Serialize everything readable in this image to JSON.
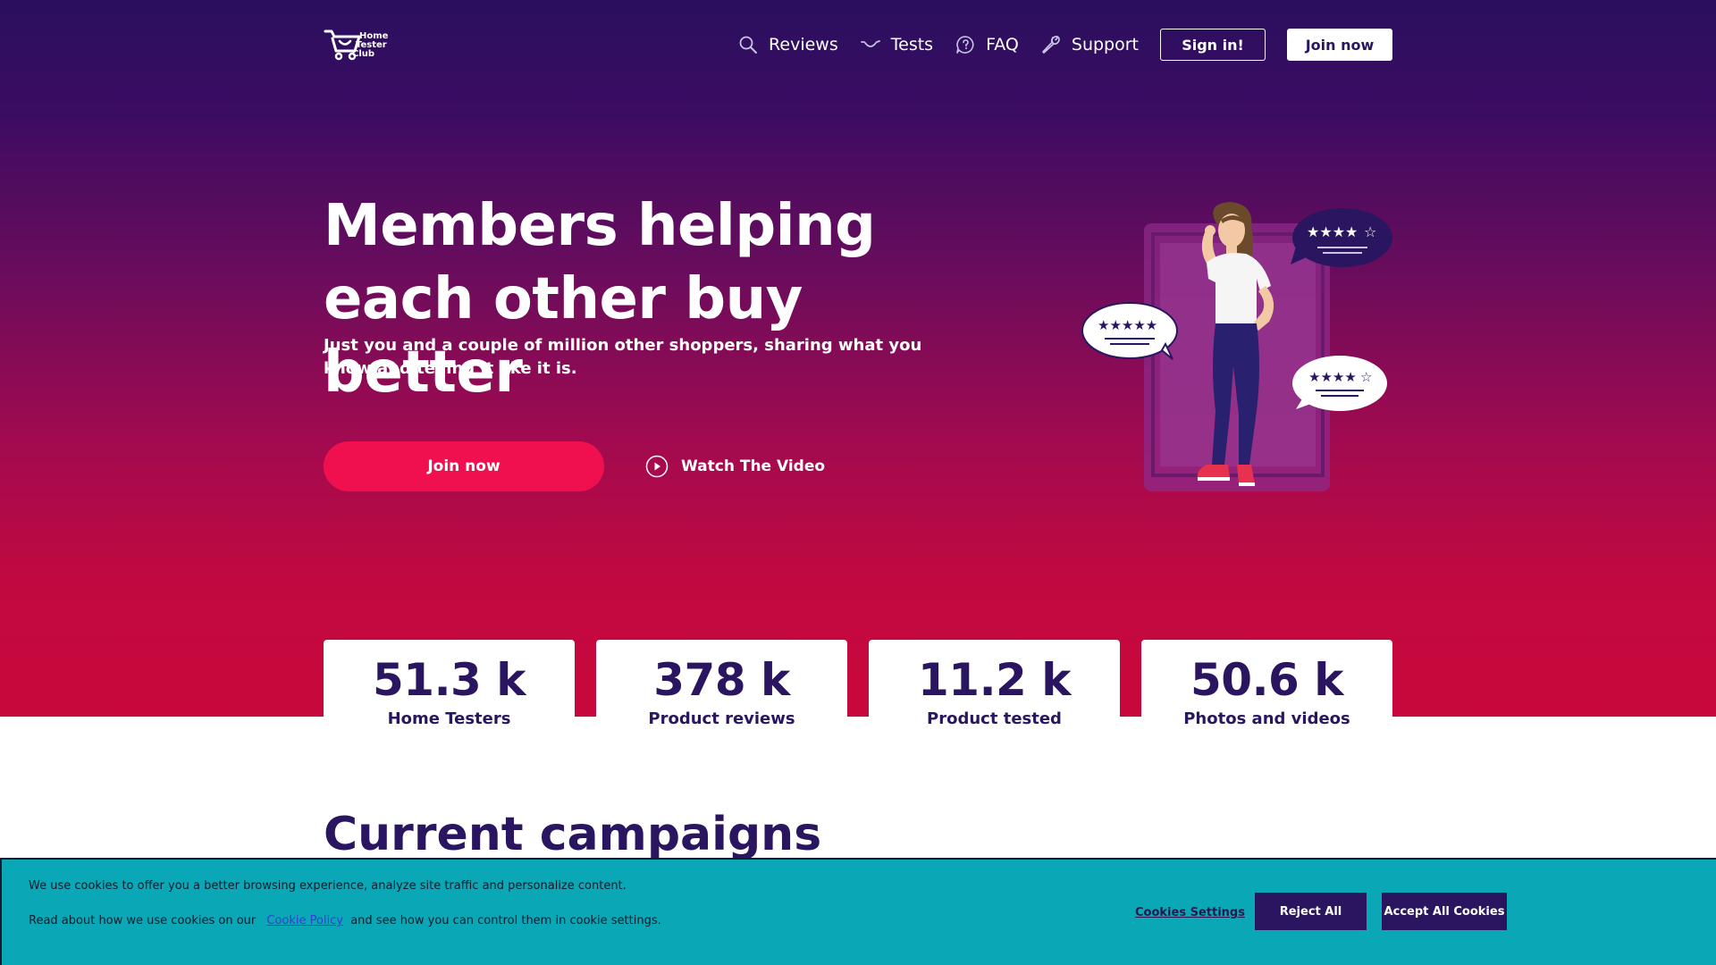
{
  "header": {
    "logo_lines": [
      "Home",
      "Tester",
      "Club"
    ],
    "nav": [
      {
        "label": "Reviews",
        "icon": "search-icon"
      },
      {
        "label": "Tests",
        "icon": "smile-icon"
      },
      {
        "label": "FAQ",
        "icon": "question-bubble-icon"
      },
      {
        "label": "Support",
        "icon": "wrench-icon"
      }
    ],
    "signin_label": "Sign in!",
    "join_label": "Join now"
  },
  "hero": {
    "title": "Members helping each other buy better",
    "subtitle": "Just you and a couple of million other shoppers, sharing what you know and telling it like it is.",
    "join_label": "Join now",
    "watch_label": "Watch The Video",
    "ratings": [
      {
        "stars": 4,
        "of": 5
      },
      {
        "stars": 5,
        "of": 5
      },
      {
        "stars": 4.5,
        "of": 5
      }
    ]
  },
  "stats": [
    {
      "value": "51.3 k",
      "label": "Home Testers"
    },
    {
      "value": "378 k",
      "label": "Product reviews"
    },
    {
      "value": "11.2 k",
      "label": "Product tested"
    },
    {
      "value": "50.6 k",
      "label": "Photos and videos"
    }
  ],
  "campaigns": {
    "title": "Current campaigns"
  },
  "cookie": {
    "line1": "We use cookies to offer you a better browsing experience, analyze site traffic and personalize content.",
    "line2_pre": "Read about how we use cookies on our",
    "link_label": "Cookie Policy",
    "line2_post": "and see how you can control them in cookie settings.",
    "settings_label": "Cookies Settings",
    "reject_label": "Reject All",
    "accept_label": "Accept All Cookies"
  },
  "colors": {
    "brand_dark": "#2a1660",
    "accent_pink": "#f0104f",
    "cookie_bg": "#0aa8b6"
  }
}
